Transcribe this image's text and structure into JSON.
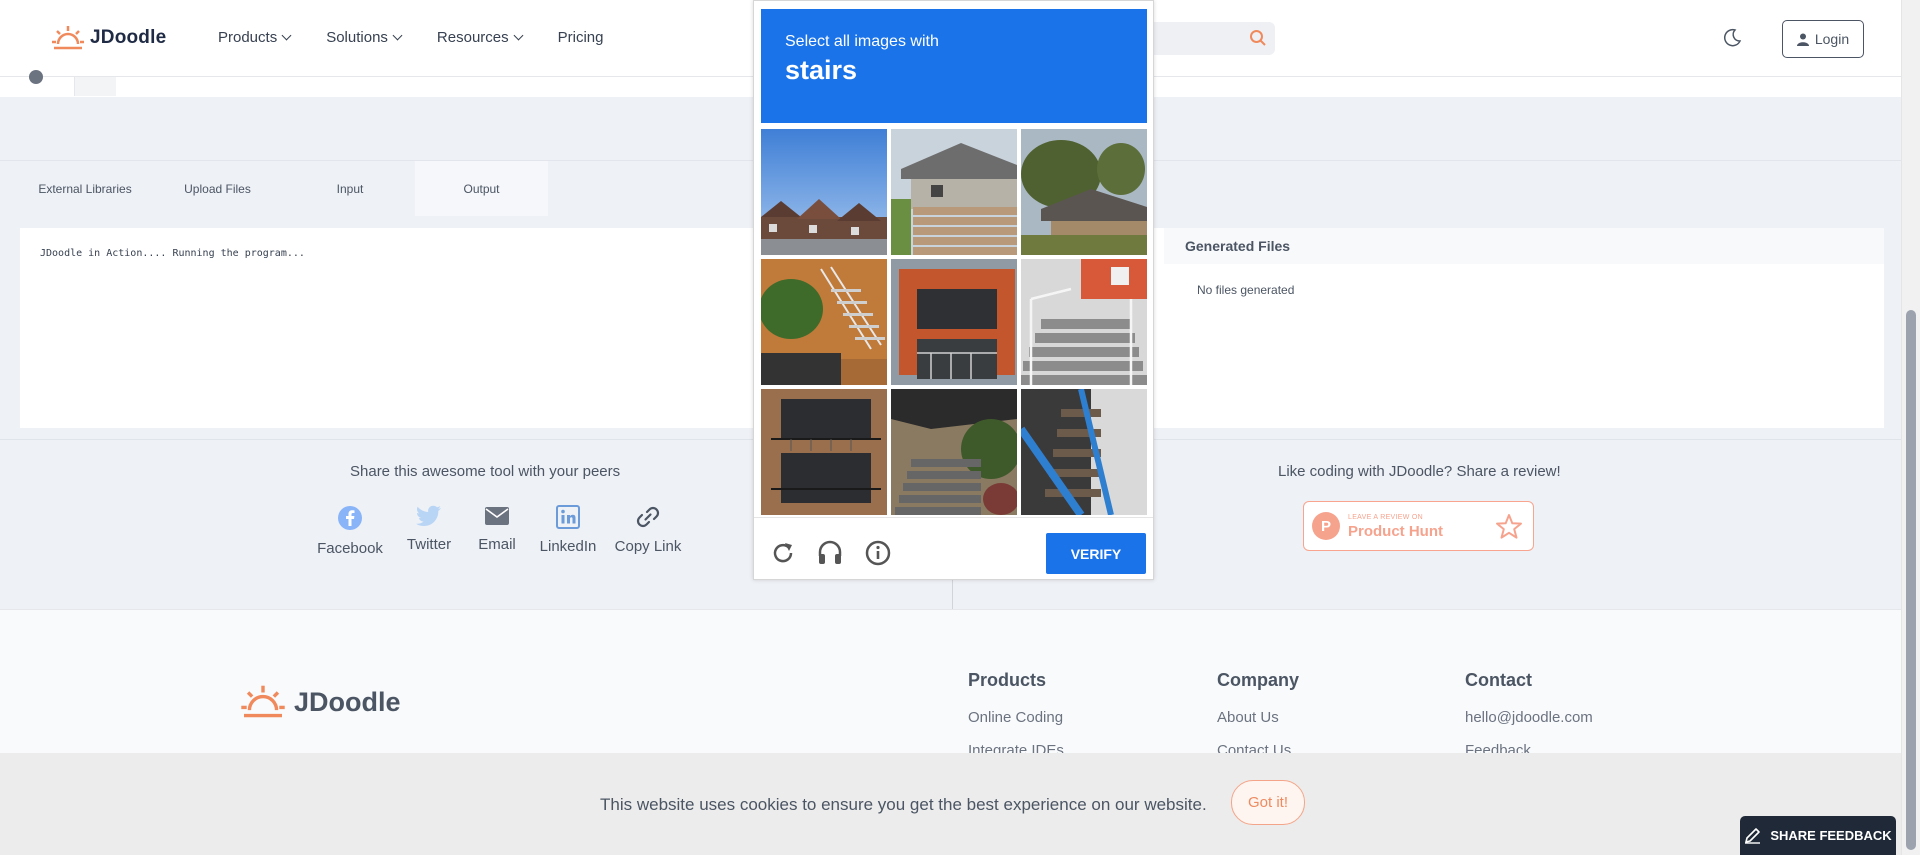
{
  "header": {
    "logo_text": "JDoodle",
    "nav": [
      {
        "label": "Products",
        "has_dropdown": true
      },
      {
        "label": "Solutions",
        "has_dropdown": true
      },
      {
        "label": "Resources",
        "has_dropdown": true
      },
      {
        "label": "Pricing",
        "has_dropdown": false
      }
    ],
    "login_label": "Login"
  },
  "tabs": [
    {
      "label": "External Libraries"
    },
    {
      "label": "Upload Files"
    },
    {
      "label": "Input"
    },
    {
      "label": "Output",
      "active": true
    }
  ],
  "output": {
    "text": "JDoodle in Action.... Running the program...",
    "generated_files_title": "Generated Files",
    "generated_files_empty": "No files generated"
  },
  "share": {
    "title": "Share this awesome tool with your peers",
    "items": [
      {
        "label": "Facebook",
        "icon": "facebook-icon"
      },
      {
        "label": "Twitter",
        "icon": "twitter-icon"
      },
      {
        "label": "Email",
        "icon": "email-icon"
      },
      {
        "label": "LinkedIn",
        "icon": "linkedin-icon"
      },
      {
        "label": "Copy Link",
        "icon": "link-icon"
      }
    ],
    "review_title": "Like coding with JDoodle? Share a review!",
    "ph_small": "LEAVE A REVIEW ON",
    "ph_big": "Product Hunt",
    "ph_letter": "P"
  },
  "footer": {
    "logo_text": "JDoodle",
    "columns": [
      {
        "title": "Products",
        "links": [
          "Online Coding",
          "Integrate IDEs"
        ]
      },
      {
        "title": "Company",
        "links": [
          "About Us",
          "Contact Us"
        ]
      },
      {
        "title": "Contact",
        "links": [
          "hello@jdoodle.com",
          "Feedback"
        ]
      }
    ]
  },
  "cookie": {
    "text": "This website uses cookies to ensure you get the best experience on our website.",
    "button": "Got it!"
  },
  "feedback_button": "SHARE FEEDBACK",
  "captcha": {
    "instruction": "Select all images with",
    "target": "stairs",
    "verify_label": "VERIFY",
    "colors": {
      "header": "#1a73e8",
      "verify": "#1a73e8"
    }
  },
  "colors": {
    "accent": "#f08a5d",
    "text": "#4b5563",
    "background": "#eef1f6"
  }
}
